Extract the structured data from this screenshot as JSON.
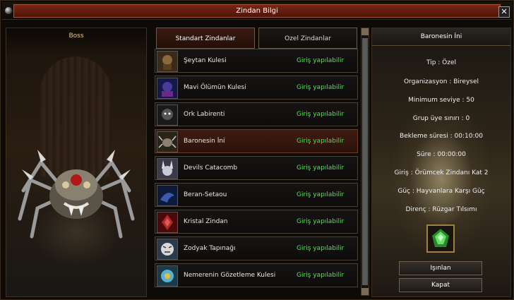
{
  "window": {
    "title": "Zindan Bilgi",
    "close_label": "✕"
  },
  "boss_panel": {
    "caption": "Boss"
  },
  "tabs": [
    {
      "label": "Standart Zindanlar",
      "active": true
    },
    {
      "label": "Ozel Zindanlar",
      "active": false
    }
  ],
  "dungeons": [
    {
      "name": "Şeytan Kulesi",
      "status": "Giriş yapılabilir",
      "icon": "demon-tower-icon"
    },
    {
      "name": "Mavi Ölümün Kulesi",
      "status": "Giriş yapılabilir",
      "icon": "blue-death-icon"
    },
    {
      "name": "Ork Labirenti",
      "status": "Giriş yapılabilir",
      "icon": "orc-icon"
    },
    {
      "name": "Baronesin İni",
      "status": "Giriş yapılabilir",
      "icon": "spider-icon",
      "selected": true
    },
    {
      "name": "Devils Catacomb",
      "status": "Giriş yapılabilir",
      "icon": "rabbit-demon-icon"
    },
    {
      "name": "Beran-Setaou",
      "status": "Giriş yapılabilir",
      "icon": "dragon-icon"
    },
    {
      "name": "Kristal Zindan",
      "status": "Giriş yapılabilir",
      "icon": "crystal-icon"
    },
    {
      "name": "Zodyak Tapınağı",
      "status": "Giriş yapılabilir",
      "icon": "tiger-icon"
    },
    {
      "name": "Nemerenin Gözetleme Kulesi",
      "status": "Giriş yapılabilir",
      "icon": "ice-icon"
    }
  ],
  "detail": {
    "title": "Baronesin İni",
    "type": "Tip : Özel",
    "organization": "Organizasyon : Bireysel",
    "min_level": "Minimum seviye : 50",
    "group_limit": "Grup üye sınırı : 0",
    "cooldown": "Bekleme süresi : 00:10:00",
    "duration": "Süre : 00:00:00",
    "entry": "Giriş : Örümcek Zindanı Kat 2",
    "power": "Güç : Hayvanlara Karşı Güç",
    "resistance": "Direnç : Rüzgar Tılsımı",
    "reward_icon": "green-crystal-icon"
  },
  "buttons": {
    "teleport": "Işınlan",
    "close": "Kapat"
  },
  "colors": {
    "status_green": "#3af03a",
    "title_red": "#7a2614",
    "selected_row": "#3e1c11"
  }
}
